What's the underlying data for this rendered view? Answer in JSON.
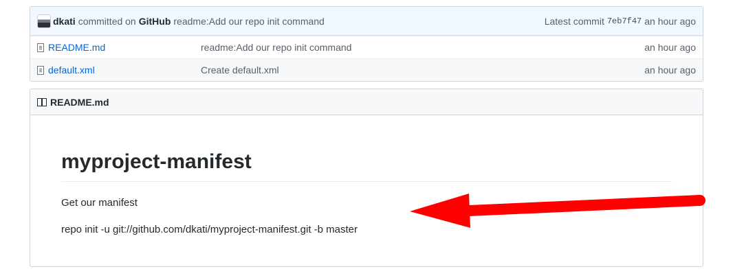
{
  "commit": {
    "author": "dkati",
    "committed_on_text": "committed on",
    "platform": "GitHub",
    "message": "readme:Add our repo init command",
    "latest_commit_label": "Latest commit",
    "sha": "7eb7f47",
    "time": "an hour ago"
  },
  "files": [
    {
      "name": "README.md",
      "message": "readme:Add our repo init command",
      "age": "an hour ago"
    },
    {
      "name": "default.xml",
      "message": "Create default.xml",
      "age": "an hour ago"
    }
  ],
  "readme": {
    "header_title": "README.md",
    "heading": "myproject-manifest",
    "paragraphs": [
      "Get our manifest",
      "repo init -u git://github.com/dkati/myproject-manifest.git -b master"
    ]
  },
  "colors": {
    "link": "#0366d6",
    "commit_bar_bg": "#f1f8ff",
    "annotation_arrow": "#ff0000"
  },
  "icons": [
    "avatar",
    "file-icon",
    "book-icon"
  ]
}
